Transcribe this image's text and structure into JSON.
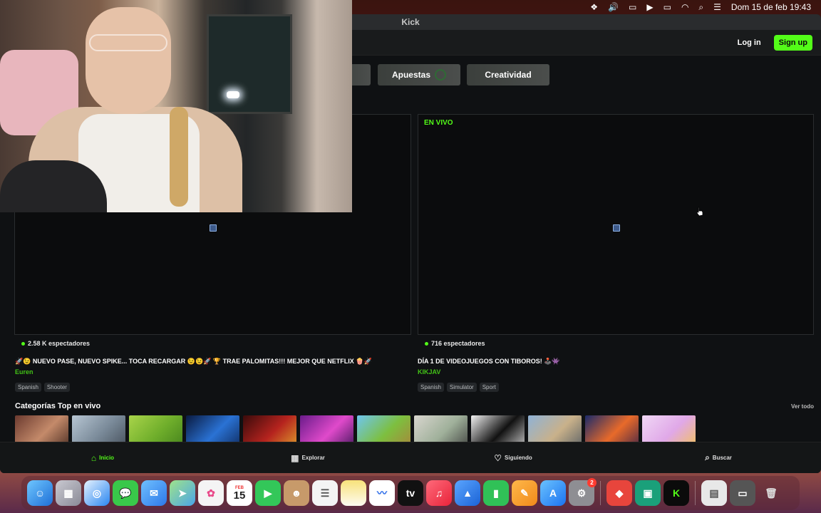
{
  "menubar": {
    "datetime": "Dom 15 de feb  19:43",
    "icons": [
      "feather-icon",
      "volume-icon",
      "screen-mirroring-icon",
      "play-icon",
      "battery-icon",
      "wifi-icon",
      "search-icon",
      "control-center-icon"
    ]
  },
  "window": {
    "title": "Kick"
  },
  "nav": {
    "login": "Log in",
    "signup": "Sign up"
  },
  "categories_buttons": [
    {
      "label": ""
    },
    {
      "label": "Apuestas"
    },
    {
      "label": "Creatividad"
    }
  ],
  "streams": [
    {
      "live_label": "",
      "viewers": "2.58 K espectadores",
      "title": "🚀😉 NUEVO PASE, NUEVO SPIKE... TOCA RECARGAR 😉😉🚀 🏆 TRAE PALOMITAS!!! MEJOR QUE NETFLIX 🍿🚀",
      "streamer": "Euren",
      "tags": [
        "Spanish",
        "Shooter"
      ]
    },
    {
      "live_label": "EN VIVO",
      "viewers": "716 espectadores",
      "title": "DÍA 1 DE VIDEOJUEGOS CON TIBOROS! 🕹️👾",
      "streamer": "KIKJAV",
      "tags": [
        "Spanish",
        "Simulator",
        "Sport"
      ]
    }
  ],
  "top_categories": {
    "title": "Categorías Top en vivo",
    "see_all": "Ver todo",
    "thumbs": [
      "just-chatting",
      "gta-v",
      "grass",
      "blue-light",
      "slots",
      "league",
      "minecraft",
      "irl",
      "film",
      "pubg",
      "space",
      "cartoon"
    ]
  },
  "bottom_nav": [
    {
      "label": "Inicio",
      "icon": "home-icon",
      "active": true
    },
    {
      "label": "Explorar",
      "icon": "grid-icon",
      "active": false
    },
    {
      "label": "Siguiendo",
      "icon": "heart-icon",
      "active": false
    },
    {
      "label": "Buscar",
      "icon": "search-icon",
      "active": false
    }
  ],
  "dock": {
    "calendar_month": "FEB",
    "calendar_day": "15",
    "settings_badge": "2",
    "apps": [
      "finder",
      "launchpad",
      "safari",
      "messages",
      "mail",
      "maps",
      "photos",
      "calendar",
      "facetime",
      "contacts",
      "reminders",
      "notes",
      "freeform",
      "tv",
      "music",
      "keynote",
      "numbers",
      "pages",
      "app-store",
      "system-settings",
      "anydesk",
      "teams-clone",
      "kick",
      "preview",
      "screen-capture",
      "trash"
    ]
  },
  "colors": {
    "kick_green": "#53fc18",
    "background": "#0f1113"
  }
}
